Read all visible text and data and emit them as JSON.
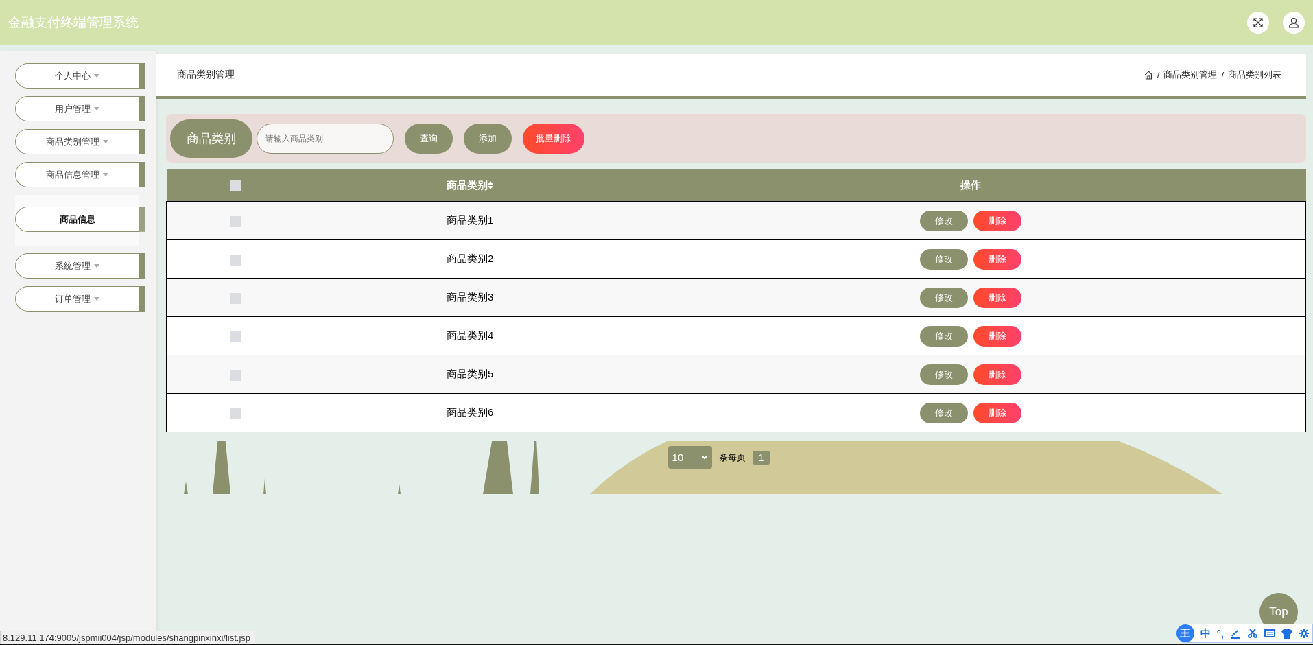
{
  "header": {
    "title": "金融支付终端管理系统"
  },
  "sidebar": {
    "items": [
      {
        "label": "个人中心"
      },
      {
        "label": "用户管理"
      },
      {
        "label": "商品类别管理"
      },
      {
        "label": "商品信息管理",
        "children": [
          {
            "label": "商品信息"
          }
        ]
      },
      {
        "label": "系统管理"
      },
      {
        "label": "订单管理"
      }
    ]
  },
  "panel": {
    "title": "商品类别管理",
    "breadcrumb": [
      {
        "separator": "/",
        "label": "商品类别管理"
      },
      {
        "separator": "/",
        "label": "商品类别列表"
      }
    ]
  },
  "search": {
    "label": "商品类别",
    "placeholder": "请输入商品类别",
    "buttons": [
      {
        "label": "查询",
        "kind": "primary"
      },
      {
        "label": "添加",
        "kind": "primary"
      },
      {
        "label": "批量删除",
        "kind": "danger"
      }
    ]
  },
  "table": {
    "all_checked": false,
    "columns": [
      "商品类别",
      "操作"
    ],
    "rows": [
      {
        "checked": false,
        "category": "商品类别1",
        "actions": [
          "修改",
          "删除"
        ]
      },
      {
        "checked": false,
        "category": "商品类别2",
        "actions": [
          "修改",
          "删除"
        ]
      },
      {
        "checked": false,
        "category": "商品类别3",
        "actions": [
          "修改",
          "删除"
        ]
      },
      {
        "checked": false,
        "category": "商品类别4",
        "actions": [
          "修改",
          "删除"
        ]
      },
      {
        "checked": false,
        "category": "商品类别5",
        "actions": [
          "修改",
          "删除"
        ]
      },
      {
        "checked": false,
        "category": "商品类别6",
        "actions": [
          "修改",
          "删除"
        ]
      }
    ]
  },
  "pagination": {
    "page_size": "10",
    "label": "条每页",
    "pages": [
      {
        "label": "1",
        "selected": true
      }
    ]
  },
  "back_to_top": "Top",
  "status_url": "8.129.11.174:9005/jspmii004/jsp/modules/shangpinxinxi/list.jsp",
  "ime_toolbar": {
    "logo": "王",
    "mode": "中",
    "punctuation": "°,"
  }
}
